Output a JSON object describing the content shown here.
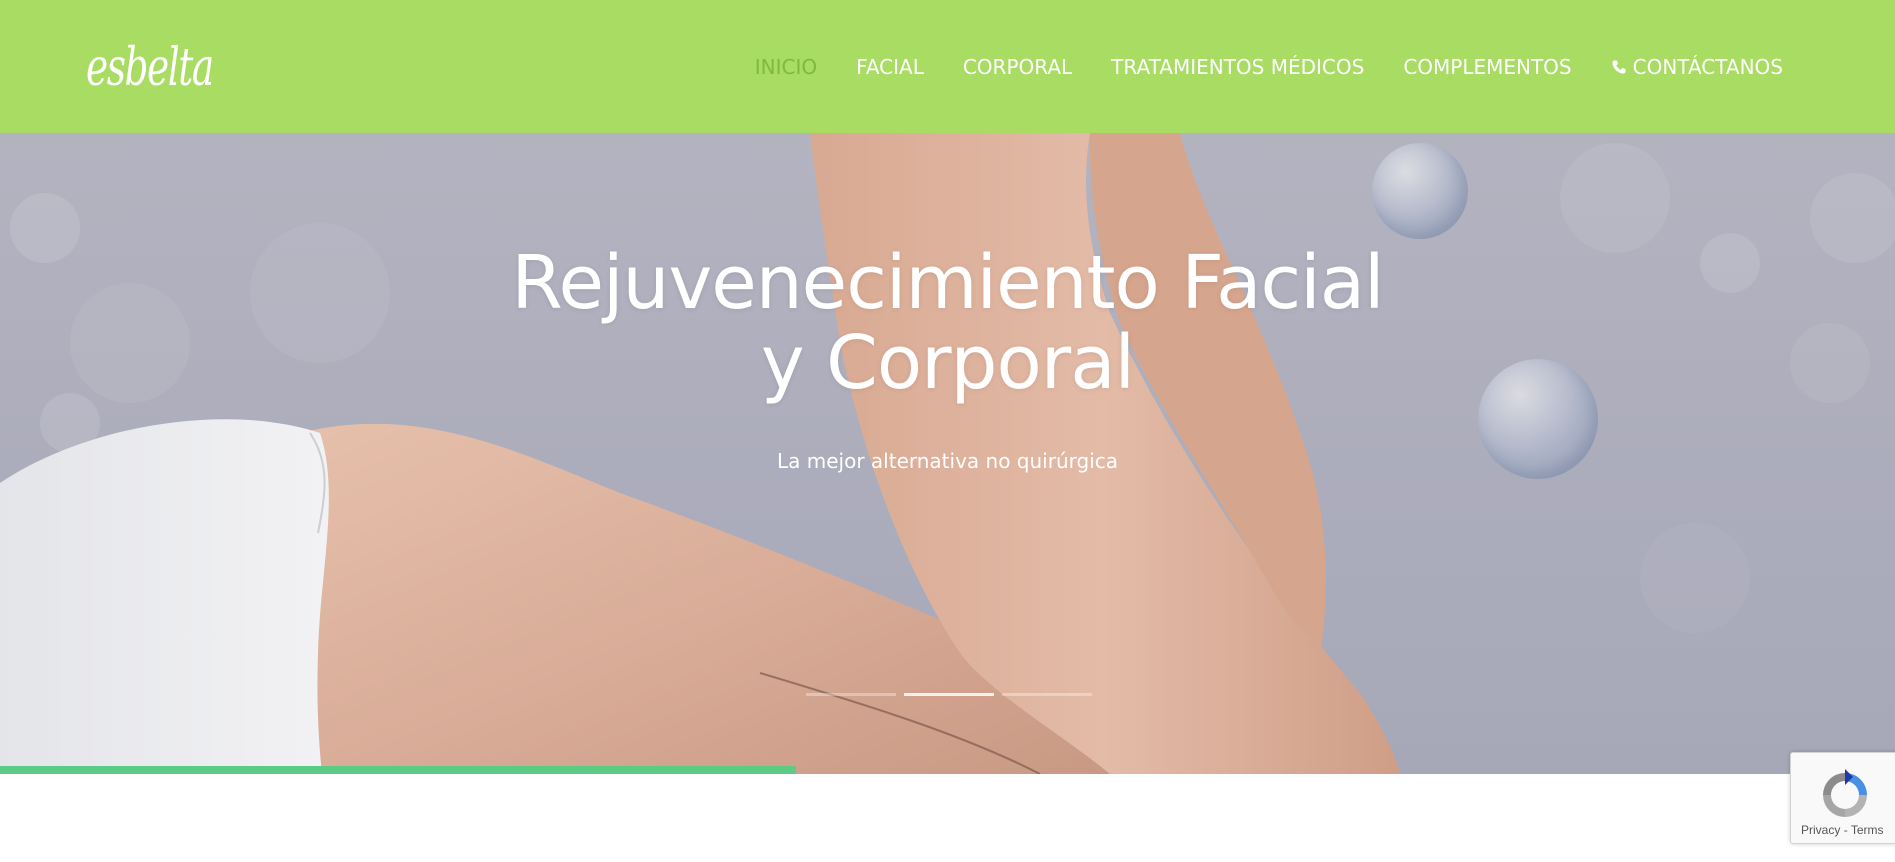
{
  "brand": {
    "logo_text": "esbelta"
  },
  "nav": {
    "items": [
      {
        "label": "INICIO",
        "active": true
      },
      {
        "label": "FACIAL",
        "active": false
      },
      {
        "label": "CORPORAL",
        "active": false
      },
      {
        "label": "TRATAMIENTOS MÉDICOS",
        "active": false
      },
      {
        "label": "COMPLEMENTOS",
        "active": false
      },
      {
        "label": "CONTÁCTANOS",
        "active": false,
        "icon": "phone-icon"
      }
    ]
  },
  "hero": {
    "title_line1": "Rejuvenecimiento Facial",
    "title_line2": "y Corporal",
    "subtitle": "La mejor alternativa no quirúrgica",
    "slides": 3,
    "active_slide": 2,
    "autoplay_progress": 0.42
  },
  "recaptcha": {
    "privacy_label": "Privacy",
    "separator": "-",
    "terms_label": "Terms"
  },
  "colors": {
    "header_bg": "#a8dc62",
    "nav_active": "#7fb943",
    "progress": "#5ccb84"
  }
}
